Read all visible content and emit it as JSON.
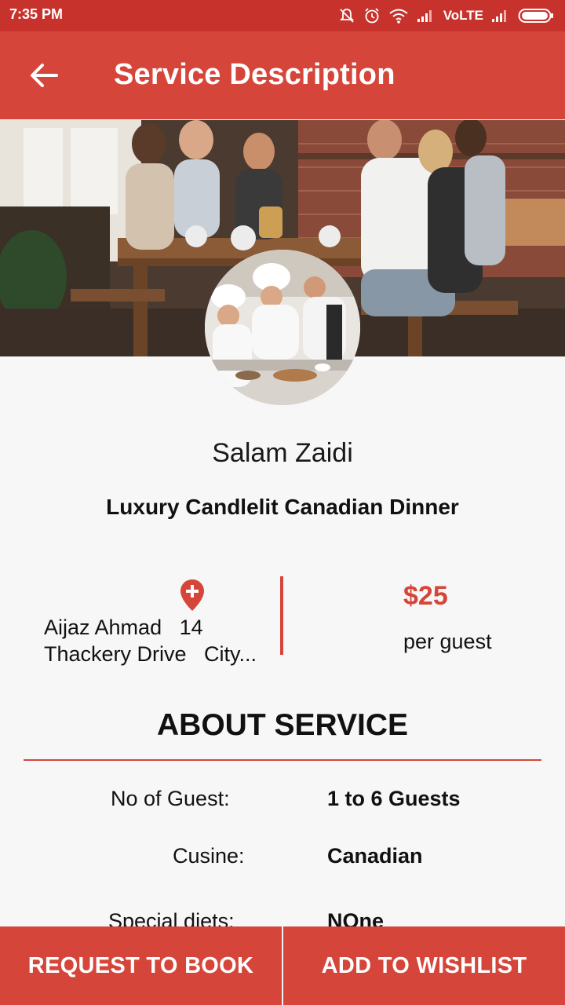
{
  "status_bar": {
    "time": "7:35 PM",
    "network_label": "VoLTE",
    "icons": [
      "mute-bell-icon",
      "alarm-icon",
      "wifi-icon",
      "signal-icon",
      "signal-icon",
      "battery-icon"
    ]
  },
  "app_bar": {
    "title": "Service Description",
    "back_icon": "arrow-left-icon"
  },
  "hero": {
    "image": "group-dinner-photo",
    "avatar_image": "chefs-kitchen-photo"
  },
  "chef": {
    "name": "Salam Zaidi"
  },
  "service": {
    "title": "Luxury Candlelit Canadian Dinner"
  },
  "location": {
    "icon": "map-pin-plus-icon",
    "line1": "Aijaz Ahmad   14",
    "line2": "Thackery Drive   City..."
  },
  "price": {
    "amount": "$25",
    "unit": "per guest"
  },
  "about": {
    "heading": "ABOUT SERVICE",
    "rows": [
      {
        "label": "No of Guest:",
        "value": "1 to 6 Guests"
      },
      {
        "label": "Cusine:",
        "value": "Canadian"
      },
      {
        "label": "Special diets:",
        "value": "NOne"
      }
    ]
  },
  "actions": {
    "request_label": "REQUEST TO BOOK",
    "wishlist_label": "ADD TO WISHLIST"
  },
  "colors": {
    "primary": "#d6453a",
    "status_bar": "#c7332c",
    "background": "#f7f7f7"
  }
}
